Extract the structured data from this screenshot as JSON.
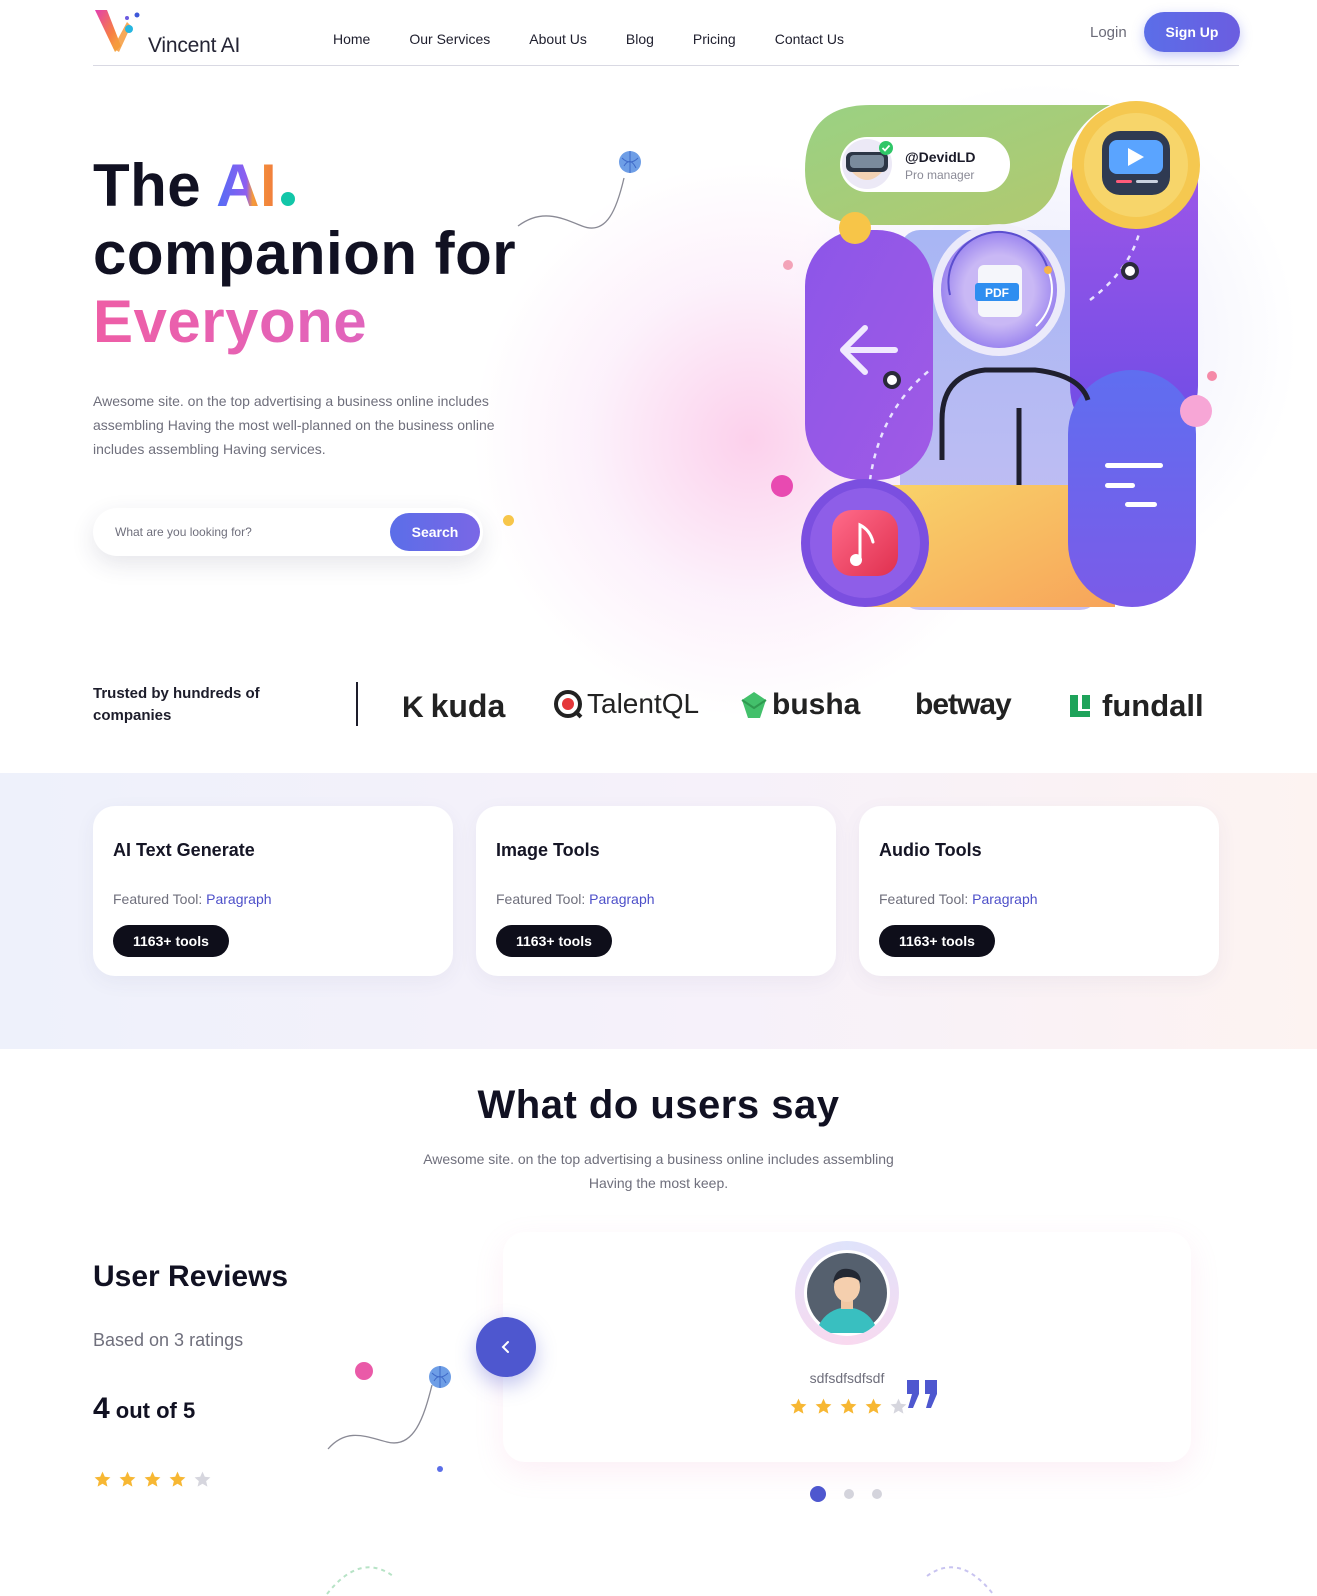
{
  "header": {
    "logo_text": "Vincent AI",
    "nav": [
      "Home",
      "Our Services",
      "About Us",
      "Blog",
      "Pricing",
      "Contact Us"
    ],
    "login_label": "Login",
    "signup_label": "Sign Up"
  },
  "hero": {
    "title_the": "The ",
    "title_ai": "AI",
    "title_line2": "companion for",
    "title_line3": "Everyone",
    "description": "Awesome site. on the top advertising a business online includes assembling Having the most well-planned on the business online includes assembling Having services.",
    "search_placeholder": "What are you looking for?",
    "search_button": "Search"
  },
  "illustration": {
    "profile_name": "@DevidLD",
    "profile_role": "Pro manager",
    "pdf_label": "PDF",
    "icons": [
      "vr-headset-avatar",
      "video-play-icon",
      "pdf-file-icon",
      "back-arrow-icon",
      "music-note-icon",
      "menu-lines-icon"
    ]
  },
  "trusted": {
    "label": "Trusted by hundreds of companies",
    "brands": [
      "kuda",
      "TalentQL",
      "busha",
      "betway",
      "fundall"
    ]
  },
  "tools": [
    {
      "title": "AI Text Generate",
      "featured_label": "Featured Tool: ",
      "featured_link": "Paragraph",
      "badge": "1163+ tools"
    },
    {
      "title": "Image Tools",
      "featured_label": "Featured Tool: ",
      "featured_link": "Paragraph",
      "badge": "1163+ tools"
    },
    {
      "title": "Audio Tools",
      "featured_label": "Featured Tool: ",
      "featured_link": "Paragraph",
      "badge": "1163+ tools"
    }
  ],
  "testimonials": {
    "title": "What do users say",
    "subtitle": "Awesome site. on the top advertising a business online includes assembling Having the most keep.",
    "reviews_title": "User Reviews",
    "based_on": "Based on 3 ratings",
    "score_value": "4",
    "score_suffix": " out of 5",
    "overall_rating": 4,
    "overall_max": 5,
    "reviewer_name": "sdfsdfsdfsdf",
    "reviewer_rating": 4,
    "prev_icon": "chevron-left-icon",
    "quote_icon": "quote-icon",
    "pager_count": 3,
    "pager_active": 1
  },
  "colors": {
    "accent": "#5b6ee8",
    "pink": "#e45fb1",
    "teal": "#12c6a8",
    "dark": "#0e0e1a",
    "star": "#f7b733",
    "star_empty": "#d6d6de"
  }
}
